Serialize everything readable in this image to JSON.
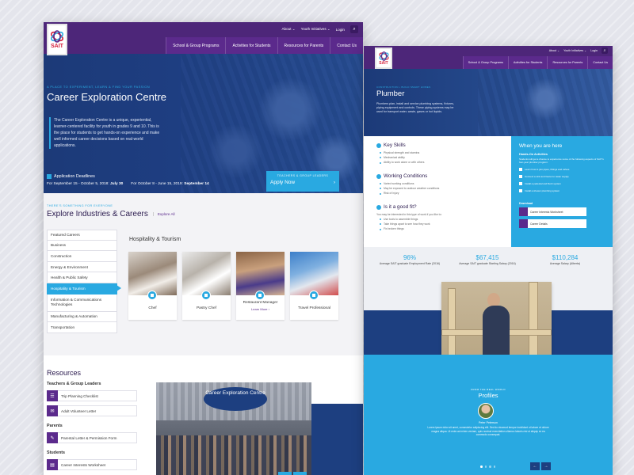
{
  "page1": {
    "logo": {
      "text": "SAIT"
    },
    "utility": {
      "about": "About ⌄",
      "youth": "Youth Initiatives ⌄",
      "login": "Login",
      "search_icon": "search-icon"
    },
    "nav": [
      "School & Group Programs",
      "Activities for Students",
      "Resources for Parents",
      "Contact Us"
    ],
    "hero": {
      "tagline": "A PLACE TO EXPERIMENT, LEARN & FIND YOUR PASSION",
      "title": "Career Exploration Centre",
      "description": "The Career Exploration Centre is a unique, experiential, learner-centered facility for youth in grades 9 and 10. This is the place for students to get hands-on experience and make well informed career decisions based on real-world applications.",
      "deadlines_title": "Application Deadlines",
      "deadline1_label": "For September 15 - October 5, 2018:",
      "deadline1_date": "July 30",
      "deadline2_label": "For October 8 - June 15, 2019:",
      "deadline2_date": "September 14",
      "apply_eyebrow": "TEACHERS & GROUP LEADERS",
      "apply_label": "Apply Now",
      "apply_arrow": "›"
    },
    "explore": {
      "eyebrow": "THERE'S SOMETHING FOR EVERYONE",
      "title": "Explore Industries & Careers",
      "explore_all": "Explore All",
      "industries": [
        "Featured Careers",
        "Business",
        "Construction",
        "Energy & Environment",
        "Health & Public Safety",
        "Hospitality & Tourism",
        "Information & Communications Technologies",
        "Manufacturing & Automation",
        "Transportation"
      ],
      "active_industry": "Hospitality & Tourism",
      "sector_title": "Hospitality & Tourism",
      "cards": [
        {
          "name": "Chef"
        },
        {
          "name": "Pastry Chef"
        },
        {
          "name": "Restaurant Manager",
          "more": "Learn More ›"
        },
        {
          "name": "Travel Professional"
        }
      ]
    },
    "resources": {
      "title": "Resources",
      "groups": {
        "teachers": "Teachers & Group Leaders",
        "parents": "Parents",
        "students": "Students"
      },
      "items": {
        "trip": "Trip Planning Checklist",
        "volunteer": "Adult Volunteer Letter",
        "permission": "Parental Letter & Permission Form",
        "interests": "Career Interests Worksheet"
      },
      "photo_banner": "Career Exploration Centre",
      "prev": "←",
      "next": "→"
    }
  },
  "page2": {
    "logo": {
      "text": "SAIT"
    },
    "utility": {
      "about": "About ⌄",
      "youth": "Youth Initiatives ⌄",
      "login": "Login"
    },
    "nav": [
      "School & Group Programs",
      "Activities for Students",
      "Resources for Parents",
      "Contact Us"
    ],
    "hero": {
      "crumb": "CONSTRUCTION • BUILD SMART HOMES",
      "title": "Plumber",
      "description": "Plumbers plan, install and service plumbing systems, fixtures, piping equipment and controls. These piping systems may be used for transport water, waste, gases or hot liquids."
    },
    "skills": {
      "key_title": "Key Skills",
      "key_items": [
        "Physical strength and stamina",
        "Mechanical ability",
        "Ability to work alone or with others"
      ],
      "working_title": "Working Conditions",
      "working_items": [
        "Varied working conditions",
        "May be exposed to outdoor weather conditions",
        "Risk of injury"
      ],
      "fit_title": "Is it a good fit?",
      "fit_sub": "You may be interested in this type of work if you like to:",
      "fit_items": [
        "Use tools to assemble things",
        "Take things apart to see how they work",
        "Fix broken things"
      ]
    },
    "here": {
      "title": "When you are here",
      "sub": "Hands-On Activities",
      "text": "Students will get a chance to experience some of the following aspects of SAIT's four-year plumber program:",
      "checks": [
        "Learn how to join pipes, fittings and valves",
        "Connect a sink and faucet to water supply",
        "Install a pedestal and flush system",
        "Install a shower plumbing system"
      ],
      "downloads_title": "Download",
      "downloads": [
        "Career Interests Worksheet",
        "Career Details"
      ]
    },
    "stats": [
      {
        "num": "96%",
        "label": "Average SAIT graduate Employment Rate (2016)"
      },
      {
        "num": "$67,415",
        "label": "Average SAIT graduate Starting Salary (2016)"
      },
      {
        "num": "$110,284",
        "label": "Average Salary (Alberta)"
      }
    ],
    "carousel": {
      "prev": "←",
      "next": "→"
    },
    "profiles": {
      "eyebrow": "FROM THE REAL WORLD",
      "title": "Profiles",
      "name": "Peter Peterson",
      "quote": "Lorem ipsum dolor sit amet, consectetur adipiscing elit. Sed do eiusmod tempor incididunt ut labore et dolore magna aliqua. Ut enim ad minim veniam, quis nostrud exercitation ullamco laboris nisi ut aliquip ex ea commodo consequat.",
      "prev": "←",
      "next": "→"
    }
  },
  "colors": {
    "purple": "#5b2a8c",
    "navy": "#1d3f80",
    "sky": "#29a9e1",
    "red": "#d4213c"
  }
}
